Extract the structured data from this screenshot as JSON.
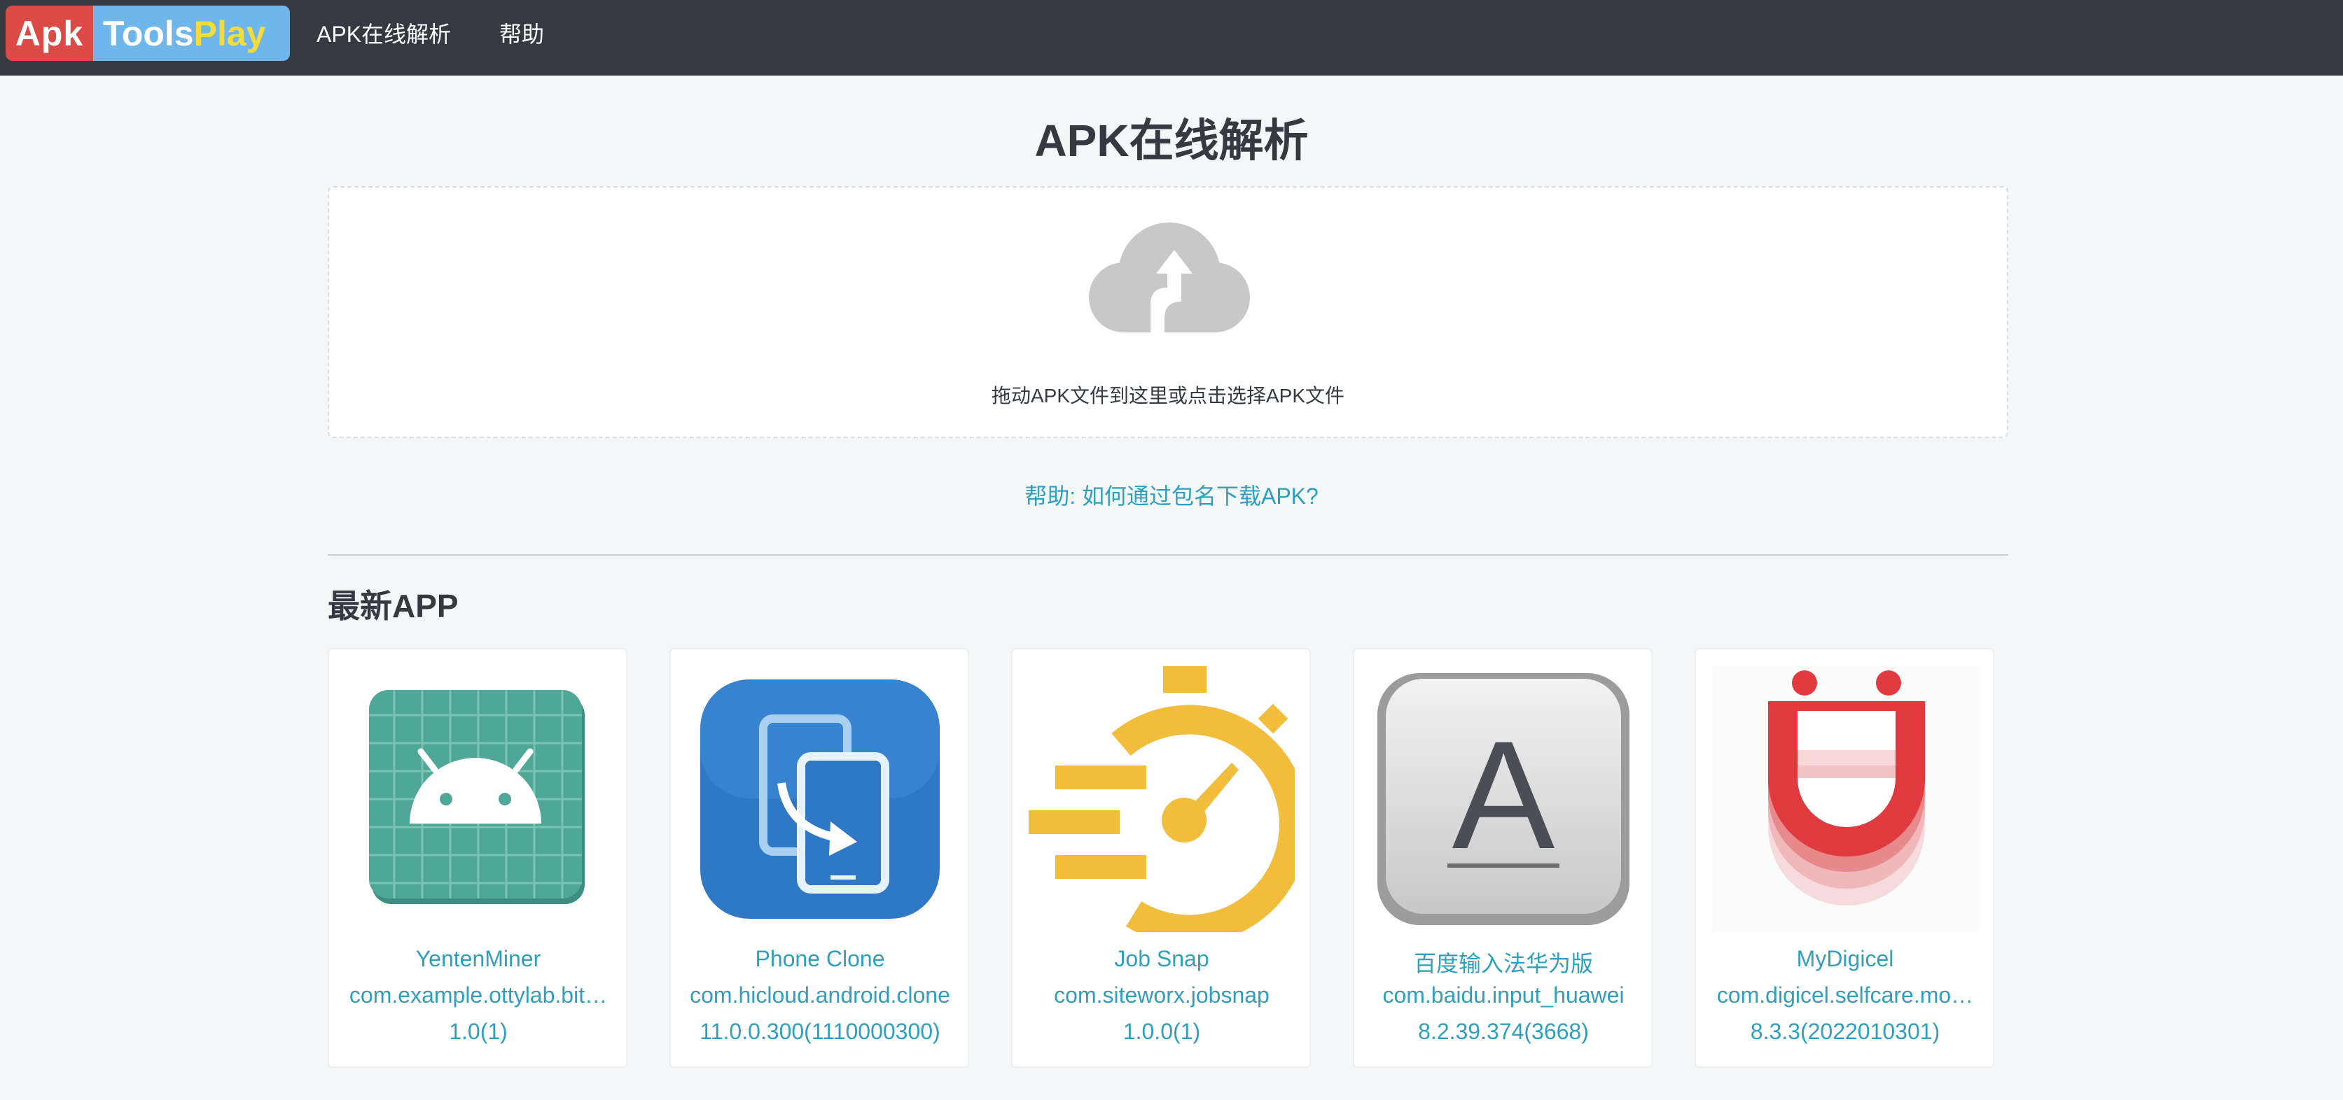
{
  "navbar": {
    "logo": {
      "apk": "Apk",
      "tools": "Tools",
      "play": "Play"
    },
    "links": [
      "APK在线解析",
      "帮助"
    ]
  },
  "main": {
    "title": "APK在线解析",
    "dropzone_text": "拖动APK文件到这里或点击选择APK文件",
    "help_link": "帮助: 如何通过包名下载APK?",
    "section_title": "最新APP"
  },
  "apps": [
    {
      "name": "YentenMiner",
      "package": "com.example.ottylab.bit…",
      "version": "1.0(1)",
      "icon": "android-icon"
    },
    {
      "name": "Phone Clone",
      "package": "com.hicloud.android.clone",
      "version": "11.0.0.300(1110000300)",
      "icon": "phone-clone-icon"
    },
    {
      "name": "Job Snap",
      "package": "com.siteworx.jobsnap",
      "version": "1.0.0(1)",
      "icon": "stopwatch-icon"
    },
    {
      "name": "百度输入法华为版",
      "package": "com.baidu.input_huawei",
      "version": "8.2.39.374(3668)",
      "icon": "letter-a-key-icon"
    },
    {
      "name": "MyDigicel",
      "package": "com.digicel.selfcare.mo…",
      "version": "8.3.3(2022010301)",
      "icon": "digicel-smile-icon"
    }
  ],
  "colors": {
    "navbar": "#343a3f",
    "logo_red": "#dc4a45",
    "logo_blue": "#6fb7ea",
    "logo_yellow": "#f5dc3e",
    "link": "#2f9fbd",
    "page_bg": "#f4f7f8"
  }
}
